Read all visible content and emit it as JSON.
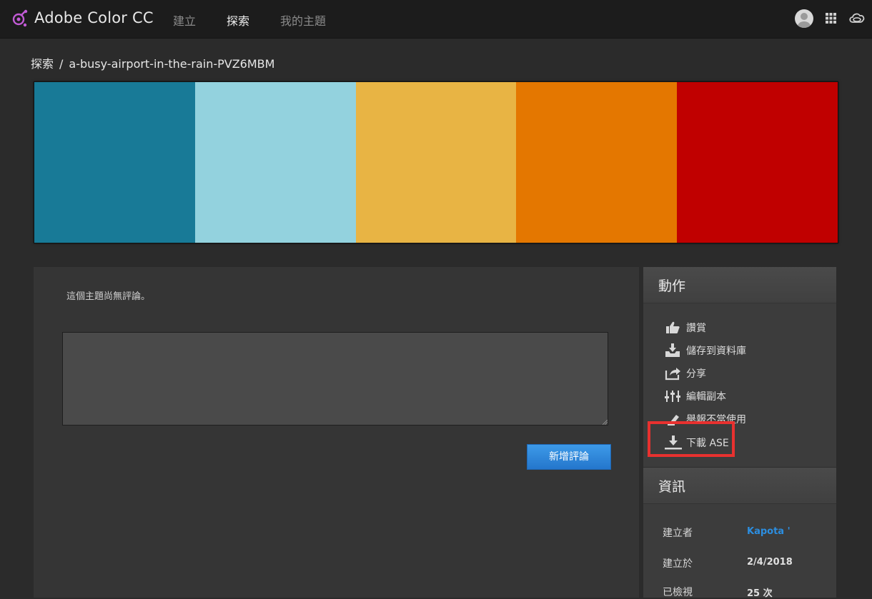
{
  "header": {
    "app_title": "Adobe Color CC",
    "nav": [
      {
        "label": "建立",
        "active": false
      },
      {
        "label": "探索",
        "active": true
      },
      {
        "label": "我的主題",
        "active": false
      }
    ],
    "icons": [
      "avatar",
      "apps-grid-icon",
      "creative-cloud-icon"
    ]
  },
  "breadcrumb": {
    "section": "探索",
    "separator": "/",
    "theme_name": "a-busy-airport-in-the-rain-PVZ6MBM"
  },
  "palette": {
    "colors": [
      "#187a97",
      "#93d2de",
      "#e8b444",
      "#e47700",
      "#c00000"
    ]
  },
  "comments": {
    "empty_message": "這個主題尚無評論。",
    "input_value": "",
    "add_button_label": "新增評論"
  },
  "actions": {
    "title": "動作",
    "items": [
      {
        "icon": "thumbs-up-icon",
        "label": "讚賞"
      },
      {
        "icon": "save-to-library-icon",
        "label": "儲存到資料庫"
      },
      {
        "icon": "share-icon",
        "label": "分享"
      },
      {
        "icon": "edit-copy-icon",
        "label": "編輯副本"
      },
      {
        "icon": "report-icon",
        "label": "舉報不當使用"
      },
      {
        "icon": "download-icon",
        "label": "下載 ASE"
      }
    ],
    "highlight_color": "#e8312f"
  },
  "info": {
    "title": "資訊",
    "rows": [
      {
        "key": "建立者",
        "value": "Kapota '"
      },
      {
        "key": "建立於",
        "value": "2/4/2018"
      },
      {
        "key": "已檢視",
        "value": "25 次"
      }
    ]
  }
}
